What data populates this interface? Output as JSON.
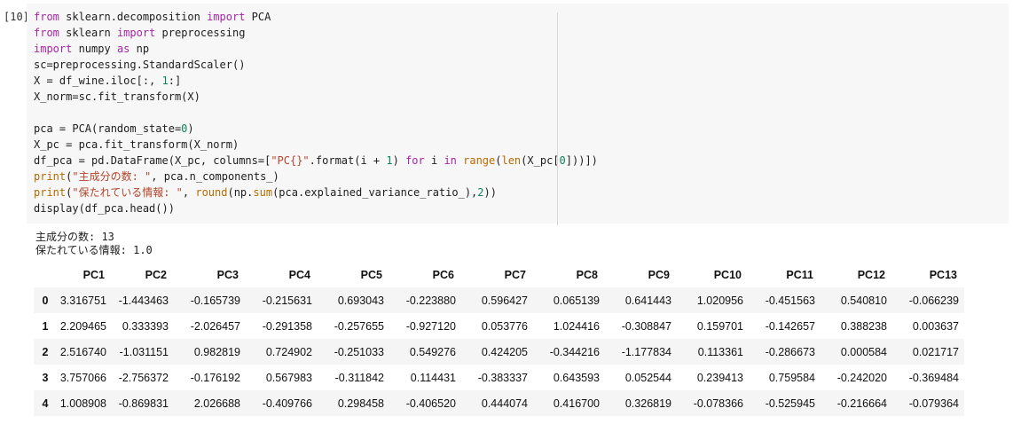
{
  "cell": {
    "prompt": "[10]",
    "code_lines": [
      [
        {
          "t": "from",
          "c": "kw"
        },
        {
          "t": " sklearn.decomposition ",
          "c": "id"
        },
        {
          "t": "import",
          "c": "kw"
        },
        {
          "t": " PCA",
          "c": "id"
        }
      ],
      [
        {
          "t": "from",
          "c": "kw"
        },
        {
          "t": " sklearn ",
          "c": "id"
        },
        {
          "t": "import",
          "c": "kw"
        },
        {
          "t": " preprocessing",
          "c": "id"
        }
      ],
      [
        {
          "t": "import",
          "c": "kw"
        },
        {
          "t": " numpy ",
          "c": "id"
        },
        {
          "t": "as",
          "c": "kw"
        },
        {
          "t": " np",
          "c": "id"
        }
      ],
      [
        {
          "t": "sc=preprocessing.StandardScaler()",
          "c": "id"
        }
      ],
      [
        {
          "t": "X = df_wine.iloc[:, ",
          "c": "id"
        },
        {
          "t": "1",
          "c": "num"
        },
        {
          "t": ":]",
          "c": "id"
        }
      ],
      [
        {
          "t": "X_norm=sc.fit_transform(X)",
          "c": "id"
        }
      ],
      [],
      [
        {
          "t": "pca = PCA(random_state=",
          "c": "id"
        },
        {
          "t": "0",
          "c": "num"
        },
        {
          "t": ")",
          "c": "id"
        }
      ],
      [
        {
          "t": "X_pc = pca.fit_transform(X_norm)",
          "c": "id"
        }
      ],
      [
        {
          "t": "df_pca = pd.DataFrame(X_pc, columns=[",
          "c": "id"
        },
        {
          "t": "\"PC{}\"",
          "c": "str"
        },
        {
          "t": ".format(i + ",
          "c": "id"
        },
        {
          "t": "1",
          "c": "num"
        },
        {
          "t": ") ",
          "c": "id"
        },
        {
          "t": "for",
          "c": "kw"
        },
        {
          "t": " i ",
          "c": "id"
        },
        {
          "t": "in",
          "c": "kw"
        },
        {
          "t": " ",
          "c": "id"
        },
        {
          "t": "range",
          "c": "fn"
        },
        {
          "t": "(",
          "c": "id"
        },
        {
          "t": "len",
          "c": "fn"
        },
        {
          "t": "(X_pc[",
          "c": "id"
        },
        {
          "t": "0",
          "c": "num"
        },
        {
          "t": "]))])",
          "c": "id"
        }
      ],
      [
        {
          "t": "print",
          "c": "fn"
        },
        {
          "t": "(",
          "c": "id"
        },
        {
          "t": "\"主成分の数: \"",
          "c": "str"
        },
        {
          "t": ", pca.n_components_)",
          "c": "id"
        }
      ],
      [
        {
          "t": "print",
          "c": "fn"
        },
        {
          "t": "(",
          "c": "id"
        },
        {
          "t": "\"保たれている情報: \"",
          "c": "str"
        },
        {
          "t": ", ",
          "c": "id"
        },
        {
          "t": "round",
          "c": "fn"
        },
        {
          "t": "(np.",
          "c": "id"
        },
        {
          "t": "sum",
          "c": "fn"
        },
        {
          "t": "(pca.explained_variance_ratio_),",
          "c": "id"
        },
        {
          "t": "2",
          "c": "num"
        },
        {
          "t": "))",
          "c": "id"
        }
      ],
      [
        {
          "t": "display(df_pca.head())",
          "c": "id"
        }
      ]
    ]
  },
  "output": {
    "lines": [
      "主成分の数: 13",
      "保たれている情報: 1.0"
    ]
  },
  "dataframe": {
    "columns": [
      "PC1",
      "PC2",
      "PC3",
      "PC4",
      "PC5",
      "PC6",
      "PC7",
      "PC8",
      "PC9",
      "PC10",
      "PC11",
      "PC12",
      "PC13"
    ],
    "rows": [
      {
        "index": "0",
        "values": [
          "3.316751",
          "-1.443463",
          "-0.165739",
          "-0.215631",
          "0.693043",
          "-0.223880",
          "0.596427",
          "0.065139",
          "0.641443",
          "1.020956",
          "-0.451563",
          "0.540810",
          "-0.066239"
        ]
      },
      {
        "index": "1",
        "values": [
          "2.209465",
          "0.333393",
          "-2.026457",
          "-0.291358",
          "-0.257655",
          "-0.927120",
          "0.053776",
          "1.024416",
          "-0.308847",
          "0.159701",
          "-0.142657",
          "0.388238",
          "0.003637"
        ]
      },
      {
        "index": "2",
        "values": [
          "2.516740",
          "-1.031151",
          "0.982819",
          "0.724902",
          "-0.251033",
          "0.549276",
          "0.424205",
          "-0.344216",
          "-1.177834",
          "0.113361",
          "-0.286673",
          "0.000584",
          "0.021717"
        ]
      },
      {
        "index": "3",
        "values": [
          "3.757066",
          "-2.756372",
          "-0.176192",
          "0.567983",
          "-0.311842",
          "0.114431",
          "-0.383337",
          "0.643593",
          "0.052544",
          "0.239413",
          "0.759584",
          "-0.242020",
          "-0.369484"
        ]
      },
      {
        "index": "4",
        "values": [
          "1.008908",
          "-0.869831",
          "2.026688",
          "-0.409766",
          "0.298458",
          "-0.406520",
          "0.444074",
          "0.416700",
          "0.326819",
          "-0.078366",
          "-0.525945",
          "-0.216664",
          "-0.079364"
        ]
      }
    ]
  }
}
